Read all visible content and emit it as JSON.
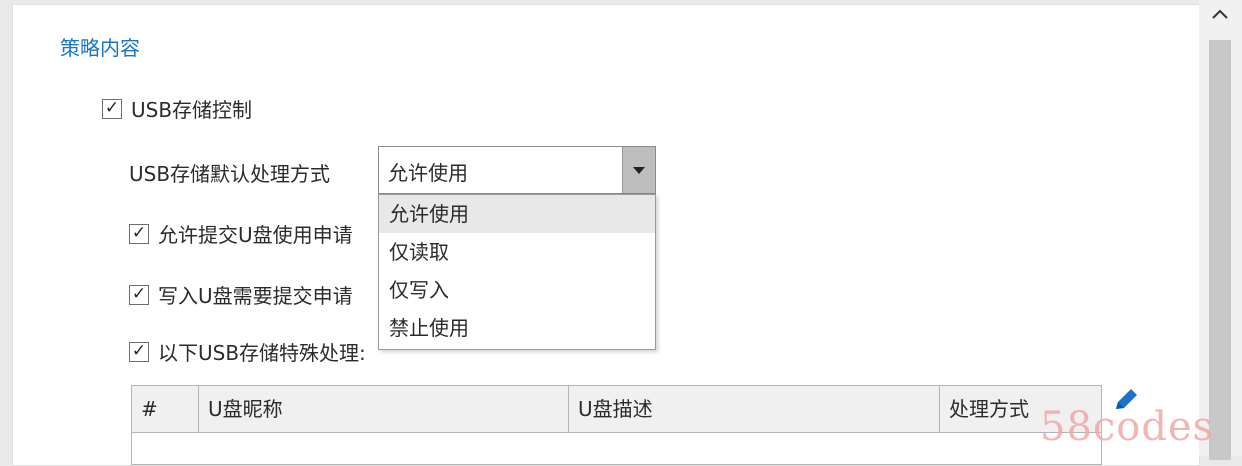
{
  "section": {
    "title": "策略内容"
  },
  "usb_control": {
    "label": "USB存储控制",
    "checked": true
  },
  "default_mode": {
    "label": "USB存储默认处理方式",
    "selected": "允许使用",
    "options": [
      "允许使用",
      "仅读取",
      "仅写入",
      "禁止使用"
    ],
    "highlighted_option": "允许使用"
  },
  "checkboxes": [
    {
      "label": "允许提交U盘使用申请",
      "checked": true
    },
    {
      "label": "写入U盘需要提交申请",
      "checked": true
    },
    {
      "label": "以下USB存储特殊处理:",
      "checked": true
    }
  ],
  "table": {
    "columns": [
      "#",
      "U盘昵称",
      "U盘描述",
      "处理方式"
    ],
    "rows": []
  },
  "icons": {
    "checkmark": "check-icon",
    "dropdown": "caret-down-icon",
    "edit": "pencil-icon",
    "scroll_up": "chevron-up-icon"
  },
  "colors": {
    "title": "#1b76c2",
    "edit_icon": "#1a73c8",
    "watermark": "#f2a7a7"
  },
  "watermark": {
    "text": "58codes"
  }
}
